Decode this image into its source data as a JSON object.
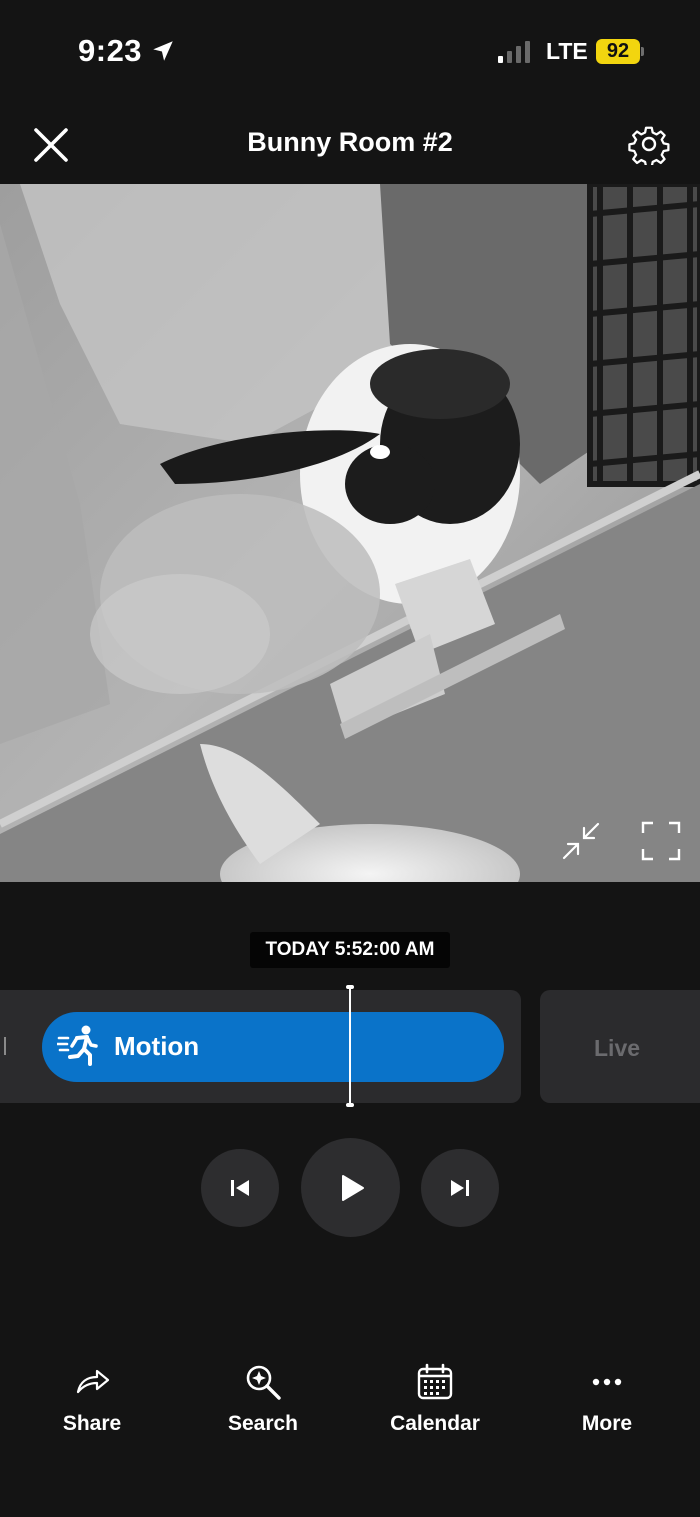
{
  "status_bar": {
    "time": "9:23",
    "network": "LTE",
    "battery": "92"
  },
  "header": {
    "title": "Bunny Room #2"
  },
  "video": {
    "description_icon": "camera-feed"
  },
  "timeline": {
    "timestamp": "TODAY 5:52:00 AM",
    "event_label": "Motion",
    "live_label": "Live",
    "event_color": "#0a73c9"
  },
  "toolbar": {
    "share_label": "Share",
    "search_label": "Search",
    "calendar_label": "Calendar",
    "more_label": "More"
  },
  "colors": {
    "background": "#141414",
    "accent": "#0a73c9",
    "battery": "#f2d50f"
  }
}
